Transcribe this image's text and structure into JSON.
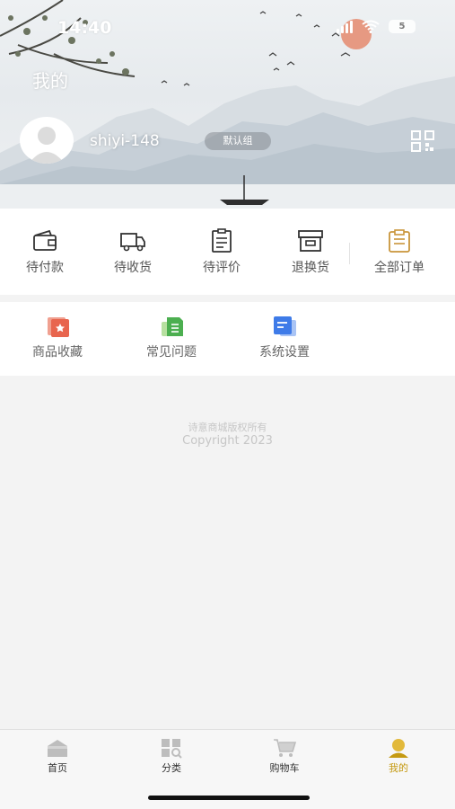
{
  "status_bar": {
    "time": "14:40",
    "battery": "5"
  },
  "header": {
    "title": "我的",
    "username": "shiyi-148",
    "group_badge": "默认组"
  },
  "orders": [
    {
      "label": "待付款",
      "icon": "wallet-icon"
    },
    {
      "label": "待收货",
      "icon": "truck-icon"
    },
    {
      "label": "待评价",
      "icon": "clipboard-icon"
    },
    {
      "label": "退换货",
      "icon": "box-icon"
    },
    {
      "label": "全部订单",
      "icon": "orders-icon"
    }
  ],
  "tools": [
    {
      "label": "商品收藏",
      "icon": "favorites-icon"
    },
    {
      "label": "常见问题",
      "icon": "faq-icon"
    },
    {
      "label": "系统设置",
      "icon": "settings-icon"
    }
  ],
  "footer": {
    "line1": "诗意商城版权所有",
    "line2": "Copyright 2023"
  },
  "tabbar": [
    {
      "label": "首页",
      "icon": "home-icon"
    },
    {
      "label": "分类",
      "icon": "category-icon"
    },
    {
      "label": "购物车",
      "icon": "cart-icon"
    },
    {
      "label": "我的",
      "icon": "profile-icon",
      "active": true
    }
  ],
  "colors": {
    "accent": "#c59a12",
    "text": "#555555",
    "inactive_tab": "#bdbdbd"
  }
}
